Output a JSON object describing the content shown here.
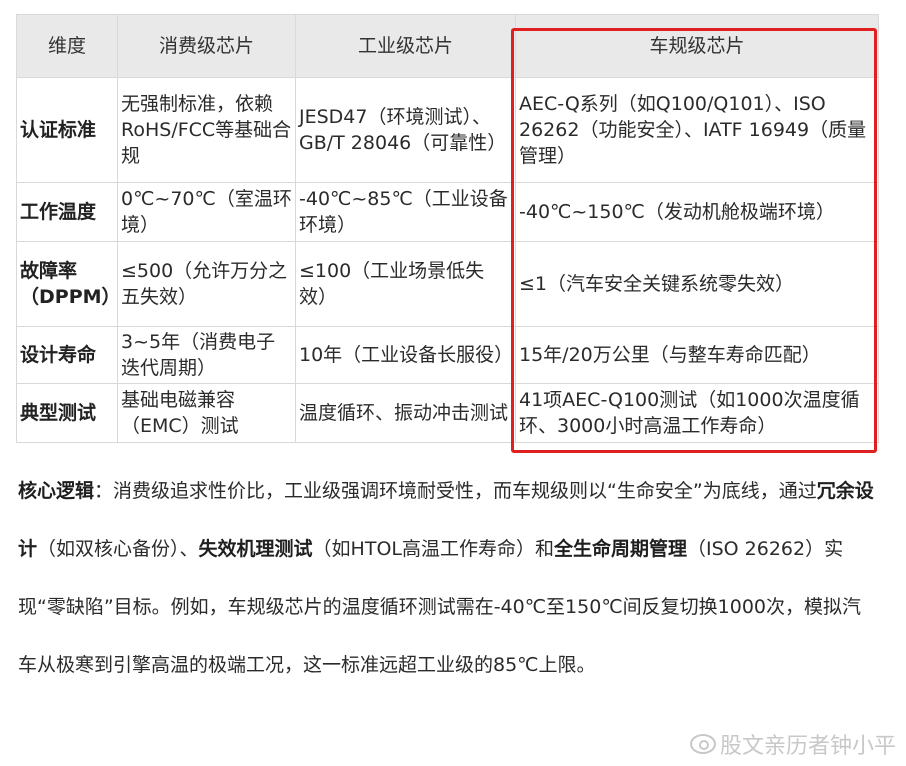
{
  "table": {
    "headers": [
      "维度",
      "消费级芯片",
      "工业级芯片",
      "车规级芯片"
    ],
    "rows": [
      [
        "认证标准",
        "无强制标准，依赖RoHS/FCC等基础合规",
        "JESD47（环境测试）、GB/T 28046（可靠性）",
        "AEC-Q系列（如Q100/Q101）、ISO 26262（功能安全）、IATF 16949（质量管理）"
      ],
      [
        "工作温度",
        "0℃~70℃（室温环境）",
        "-40℃~85℃（工业设备环境）",
        "-40℃~150℃（发动机舱极端环境）"
      ],
      [
        "故障率（DPPM）",
        "≤500（允许万分之五失效）",
        "≤100（工业场景低失效）",
        "≤1（汽车安全关键系统零失效）"
      ],
      [
        "设计寿命",
        "3~5年（消费电子迭代周期）",
        "10年（工业设备长服役）",
        "15年/20万公里（与整车寿命匹配）"
      ],
      [
        "典型测试",
        "基础电磁兼容（EMC）测试",
        "温度循环、振动冲击测试",
        "41项AEC-Q100测试（如1000次温度循环、3000小时高温工作寿命）"
      ]
    ]
  },
  "paragraph": {
    "lead": "核心逻辑",
    "t1": "：消费级追求性价比，工业级强调环境耐受性，而车规级则以“生命安全”为底线，通过",
    "b1": "冗余设计",
    "t2": "（如双核心备份）、",
    "b2": "失效机理测试",
    "t3": "（如HTOL高温工作寿命）和",
    "b3": "全生命周期管理",
    "t4": "（ISO 26262）实现“零缺陷”目标。例如，车规级芯片的温度循环测试需在-40℃至150℃间反复切换1000次，模拟汽车从极寒到引擎高温的极端工况，这一标准远超工业级的85℃上限。"
  },
  "watermark": {
    "icon": "weibo-icon",
    "text": "股文亲历者钟小平"
  },
  "colors": {
    "highlight": "#e02020",
    "header_bg": "#e9e9e9"
  }
}
